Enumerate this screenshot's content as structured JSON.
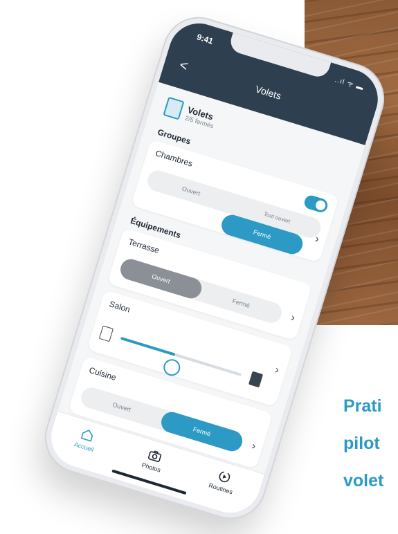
{
  "marketing": {
    "lines": [
      "Prati",
      "pilot",
      "volet"
    ]
  },
  "status": {
    "time": "9:41",
    "signal": "..ıl ᯤ ▬"
  },
  "nav": {
    "back": "<",
    "title": "Volets"
  },
  "summary": {
    "title": "Volets",
    "subtitle": "2/5 fermés"
  },
  "groups": {
    "title": "Groupes",
    "items": [
      {
        "label": "Chambres",
        "toggle_on": true,
        "open": "Ouvert",
        "closed": "Fermé",
        "extra": "Tout ouvert",
        "selected": "Fermé"
      }
    ]
  },
  "devices": {
    "title": "Équipements",
    "items": [
      {
        "label": "Terrasse",
        "open": "Ouvert",
        "closed": "Fermé",
        "selected": "Ouvert"
      },
      {
        "label": "Salon",
        "level": 0.45
      },
      {
        "label": "Cuisine",
        "open": "Ouvert",
        "closed": "Fermé",
        "selected": "Fermé"
      }
    ]
  },
  "tabs": [
    {
      "label": "Accueil",
      "icon": "home-icon",
      "active": true
    },
    {
      "label": "Photos",
      "icon": "camera-icon",
      "active": false
    },
    {
      "label": "Routines",
      "icon": "routines-icon",
      "active": false
    }
  ],
  "colors": {
    "accent": "#2c9ac5",
    "header": "#2e3f4f",
    "wood": "#8a5a36"
  }
}
